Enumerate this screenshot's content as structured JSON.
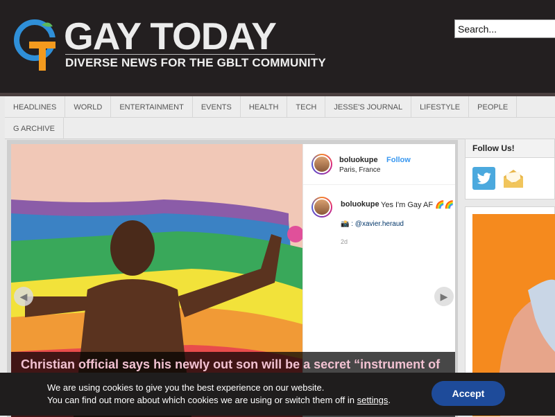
{
  "header": {
    "site_title": "GAY TODAY",
    "tagline": "DIVERSE NEWS FOR THE GBLT COMMUNITY",
    "logo_initials": "GT"
  },
  "search": {
    "placeholder": "Search..."
  },
  "nav": {
    "row1": [
      "HEADLINES",
      "WORLD",
      "ENTERTAINMENT",
      "EVENTS",
      "HEALTH",
      "TECH",
      "JESSE'S JOURNAL",
      "LIFESTYLE",
      "PEOPLE"
    ],
    "row2": [
      "G ARCHIVE"
    ]
  },
  "slider": {
    "headline": "Christian official says his newly out son will be a secret “instrument of",
    "prev_icon": "chevron-left-icon",
    "next_icon": "chevron-right-icon"
  },
  "instagram": {
    "username": "boluokupe",
    "follow_label": "Follow",
    "location": "Paris, France",
    "caption": "Yes I'm Gay AF 🌈🌈",
    "credit": "📸 : @xavier.heraud",
    "time": "2d"
  },
  "sidebar": {
    "follow_title": "Follow Us!",
    "icons": [
      "twitter-icon",
      "mail-icon"
    ]
  },
  "cookie": {
    "line1": "We are using cookies to give you the best experience on our website.",
    "line2_prefix": "You can find out more about which cookies we are using or switch them off in ",
    "settings_link": "settings",
    "line2_suffix": ".",
    "accept_label": "Accept"
  },
  "colors": {
    "header_bg": "#231f20",
    "nav_bg": "#ededed",
    "accept_button": "#1e4b9a",
    "twitter": "#4ba9de",
    "headline_text": "#f2c2d2"
  }
}
